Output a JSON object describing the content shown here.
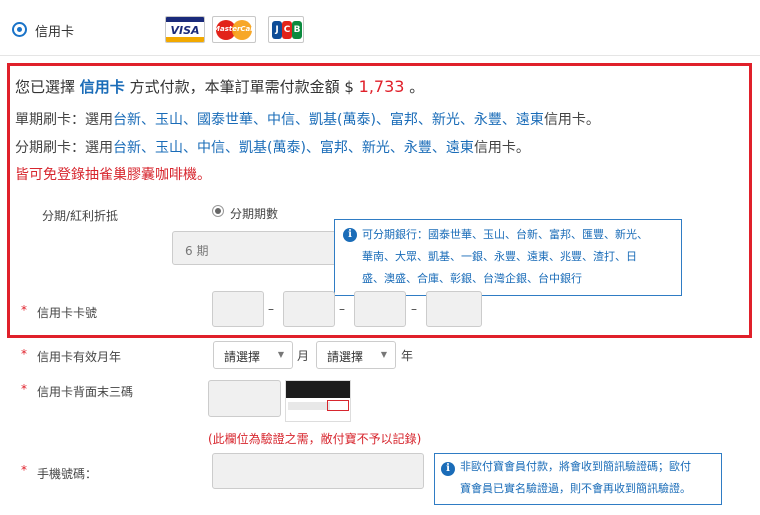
{
  "payment": {
    "method_label": "信用卡",
    "card_logos": [
      {
        "name": "visa-logo",
        "text": "VISA"
      },
      {
        "name": "mastercard-logo",
        "text": "MasterCard"
      },
      {
        "name": "jcb-logo",
        "text": "JCB"
      }
    ]
  },
  "summary": {
    "prefix": "您已選擇 ",
    "method": "信用卡",
    "middle": " 方式付款，本筆訂單需付款金額 $ ",
    "amount": "1,733",
    "suffix": " 。"
  },
  "banks": {
    "single_prefix": "單期刷卡：選用",
    "single_banks": "台新、玉山、國泰世華、中信、凱基(萬泰)、富邦、新光、永豐、遠東",
    "single_suffix": "信用卡。",
    "install_prefix": "分期刷卡：選用",
    "install_banks": "台新、玉山、中信、凱基(萬泰)、富邦、新光、永豐、遠東",
    "install_suffix": "信用卡。",
    "promo_prefix": "皆可",
    "promo_text": "免登錄抽雀巢膠囊咖啡機。"
  },
  "form": {
    "installment_label": "分期/紅利折抵",
    "installment_option": "分期期數",
    "installment_value": "6 期",
    "card_number_label": "信用卡卡號",
    "card_number_dash": "–",
    "expiry_label": "信用卡有效月年",
    "expiry_month_placeholder": "請選擇",
    "expiry_month_unit": "月",
    "expiry_year_placeholder": "請選擇",
    "expiry_year_unit": "年",
    "cvv_label": "信用卡背面末三碼",
    "cvv_note": "(此欄位為驗證之需，敝付寶不予以記錄)",
    "phone_label": "手機號碼：",
    "required_mark": "*"
  },
  "info": {
    "install_banks_line1": "可分期銀行：國泰世華、玉山、台新、富邦、匯豐、新光、",
    "install_banks_line2": "華南、大眾、凱基、一銀、永豐、遠東、兆豐、渣打、日",
    "install_banks_line3": "盛、澳盛、合庫、彰銀、台灣企銀、台中銀行",
    "phone_line1": "非歐付寶會員付款，將會收到簡訊驗證碼；歐付",
    "phone_line2": "寶會員已實名驗證過，則不會再收到簡訊驗證。",
    "icon": "i"
  },
  "colors": {
    "accent_blue": "#1a6cb8",
    "highlight_red": "#e0202a",
    "info_border": "#2f7cc4"
  }
}
